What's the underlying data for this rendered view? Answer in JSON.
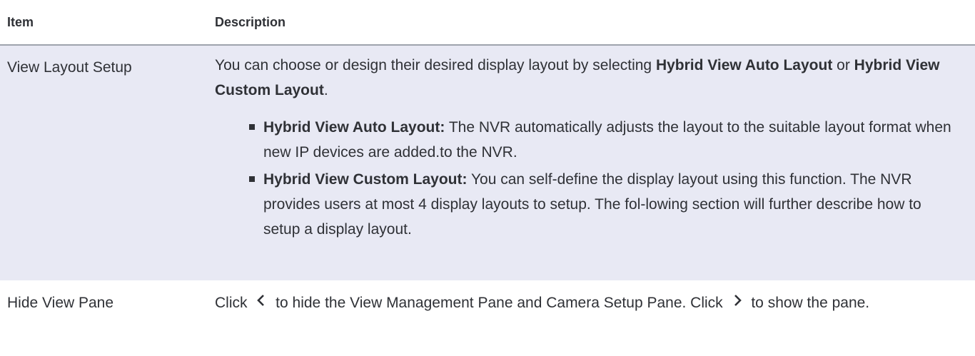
{
  "header": {
    "item": "Item",
    "description": "Description"
  },
  "rows": [
    {
      "item": "View Layout Setup",
      "desc_intro_1": "You can choose or design their desired display layout by selecting ",
      "desc_bold_1": "Hybrid View Auto Layout",
      "desc_intro_2": " or ",
      "desc_bold_2": "Hybrid View Custom Layout",
      "desc_intro_3": ".",
      "bullets": [
        {
          "title": "Hybrid View Auto Layout:",
          "text": " The NVR automatically adjusts the layout to the suitable layout format when new IP devices are added.to the NVR."
        },
        {
          "title": "Hybrid View Custom Layout:",
          "text": " You can self-define the display layout using this function. The NVR provides users at most 4 display layouts to setup. The fol-lowing section will further describe how to setup a display layout."
        }
      ]
    },
    {
      "item": "Hide View Pane",
      "desc_1": "Click ",
      "icon_left": "chevron-left-icon",
      "desc_2": " to hide the View Management Pane and Camera Setup Pane. Click ",
      "icon_right": "chevron-right-icon",
      "desc_3": " to show the pane."
    }
  ]
}
